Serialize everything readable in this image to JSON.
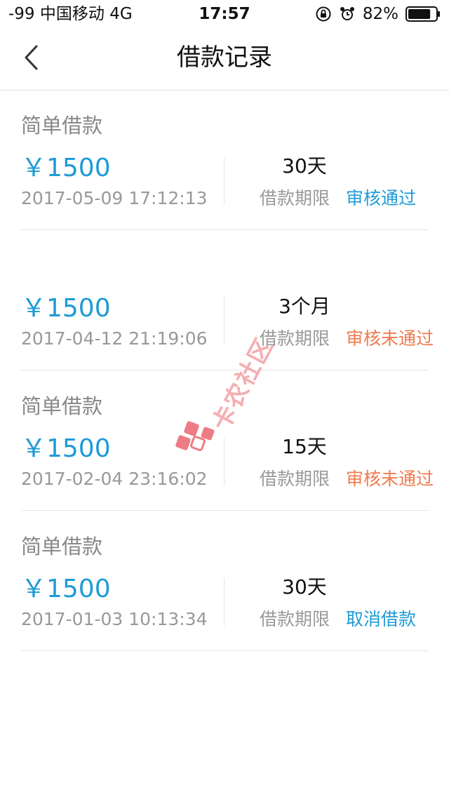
{
  "status_bar": {
    "left": "-99 中国移动   4G",
    "time": "17:57",
    "battery": "82%",
    "battery_level": 0.82
  },
  "nav": {
    "title": "借款记录",
    "back_icon": "chevron-left-icon"
  },
  "records": [
    {
      "type": "简单借款",
      "amount": "￥1500",
      "time": "2017-05-09 17:12:13",
      "term": "30天",
      "term_label": "借款期限",
      "status": "审核通过",
      "status_color": "#1e9bd7"
    },
    {
      "type": "",
      "amount": "￥1500",
      "time": "2017-04-12 21:19:06",
      "term": "3个月",
      "term_label": "借款期限",
      "status": "审核未通过",
      "status_color": "#f07a4e"
    },
    {
      "type": "简单借款",
      "amount": "￥1500",
      "time": "2017-02-04 23:16:02",
      "term": "15天",
      "term_label": "借款期限",
      "status": "审核未通过",
      "status_color": "#f07a4e"
    },
    {
      "type": "简单借款",
      "amount": "￥1500",
      "time": "2017-01-03 10:13:34",
      "term": "30天",
      "term_label": "借款期限",
      "status": "取消借款",
      "status_color": "#1e9bd7"
    }
  ],
  "watermark": {
    "text": "卡农社区"
  },
  "colors": {
    "accent_blue": "#1e9bd7",
    "accent_orange": "#f07a4e",
    "text_gray": "#999999"
  }
}
